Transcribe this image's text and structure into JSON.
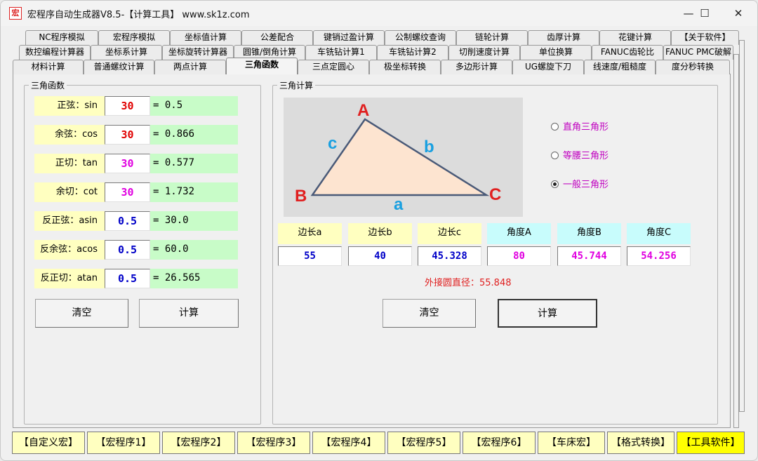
{
  "window": {
    "icon_glyph": "宏",
    "title": "宏程序自动生成器V8.5-【计算工具】    www.sk1z.com",
    "controls": {
      "minimize": "—",
      "maximize": "☐",
      "close": "✕"
    }
  },
  "tabs": {
    "row1": [
      "NC程序模拟",
      "宏程序模拟",
      "坐标值计算",
      "公差配合",
      "键销过盈计算",
      "公制螺纹查询",
      "链轮计算",
      "齿厚计算",
      "花键计算",
      "【关于软件】"
    ],
    "row2": [
      "数控编程计算器",
      "坐标系计算",
      "坐标旋转计算器",
      "圆锥/倒角计算",
      "车铣钻计算1",
      "车铣钻计算2",
      "切削速度计算",
      "单位换算",
      "FANUC齿轮比",
      "FANUC PMC破解"
    ],
    "row3": [
      "材料计算",
      "普通螺纹计算",
      "两点计算",
      "三角函数",
      "三点定圆心",
      "极坐标转换",
      "多边形计算",
      "UG螺旋下刀",
      "线速度/粗糙度",
      "度分秒转换"
    ],
    "active": "三角函数"
  },
  "trig": {
    "legend": "三角函数",
    "rows": [
      {
        "label": "正弦：sin",
        "input": "30",
        "eq": "=",
        "result": "0.5"
      },
      {
        "label": "余弦：cos",
        "input": "30",
        "eq": "=",
        "result": "0.866"
      },
      {
        "label": "正切：tan",
        "input": "30",
        "eq": "=",
        "result": "0.577"
      },
      {
        "label": "余切：cot",
        "input": "30",
        "eq": "=",
        "result": "1.732"
      },
      {
        "label": "反正弦：asin",
        "input": "0.5",
        "eq": "=",
        "result": "30.0"
      },
      {
        "label": "反余弦：acos",
        "input": "0.5",
        "eq": "=",
        "result": "60.0"
      },
      {
        "label": "反正切：atan",
        "input": "0.5",
        "eq": "=",
        "result": "26.565"
      }
    ],
    "clear_label": "清空",
    "calc_label": "计算"
  },
  "triangle": {
    "legend": "三角计算",
    "vertex_a": "A",
    "vertex_b": "B",
    "vertex_c": "C",
    "side_a": "a",
    "side_b": "b",
    "side_c": "c",
    "options": [
      "直角三角形",
      "等腰三角形",
      "一般三角形"
    ],
    "selected_option": "一般三角形",
    "headers": [
      "边长a",
      "边长b",
      "边长c",
      "角度A",
      "角度B",
      "角度C"
    ],
    "values": [
      "55",
      "40",
      "45.328",
      "80",
      "45.744",
      "54.256"
    ],
    "circumcircle": "外接圆直径：55.848",
    "clear_label": "清空",
    "calc_label": "计算"
  },
  "bottom_buttons": [
    "【自定义宏】",
    "【宏程序1】",
    "【宏程序2】",
    "【宏程序3】",
    "【宏程序4】",
    "【宏程序5】",
    "【宏程序6】",
    "【车床宏】",
    "【格式转换】",
    "【工具软件】"
  ],
  "bottom_active": "【工具软件】",
  "colors": {
    "label_bg": "#ffffc0",
    "result_bg": "#c8fcc8",
    "angle_header_bg": "#c8fcfc",
    "input_red": "#e00000",
    "input_magenta": "#e000e0",
    "input_blue": "#0000c8",
    "triangle_fill": "#fde4d0",
    "vertex_red": "#e02020",
    "side_blue": "#1aa0e0",
    "radio_text": "#c000c0",
    "circumcircle_text": "#e02020",
    "active_bottom_bg": "#ffff00"
  }
}
